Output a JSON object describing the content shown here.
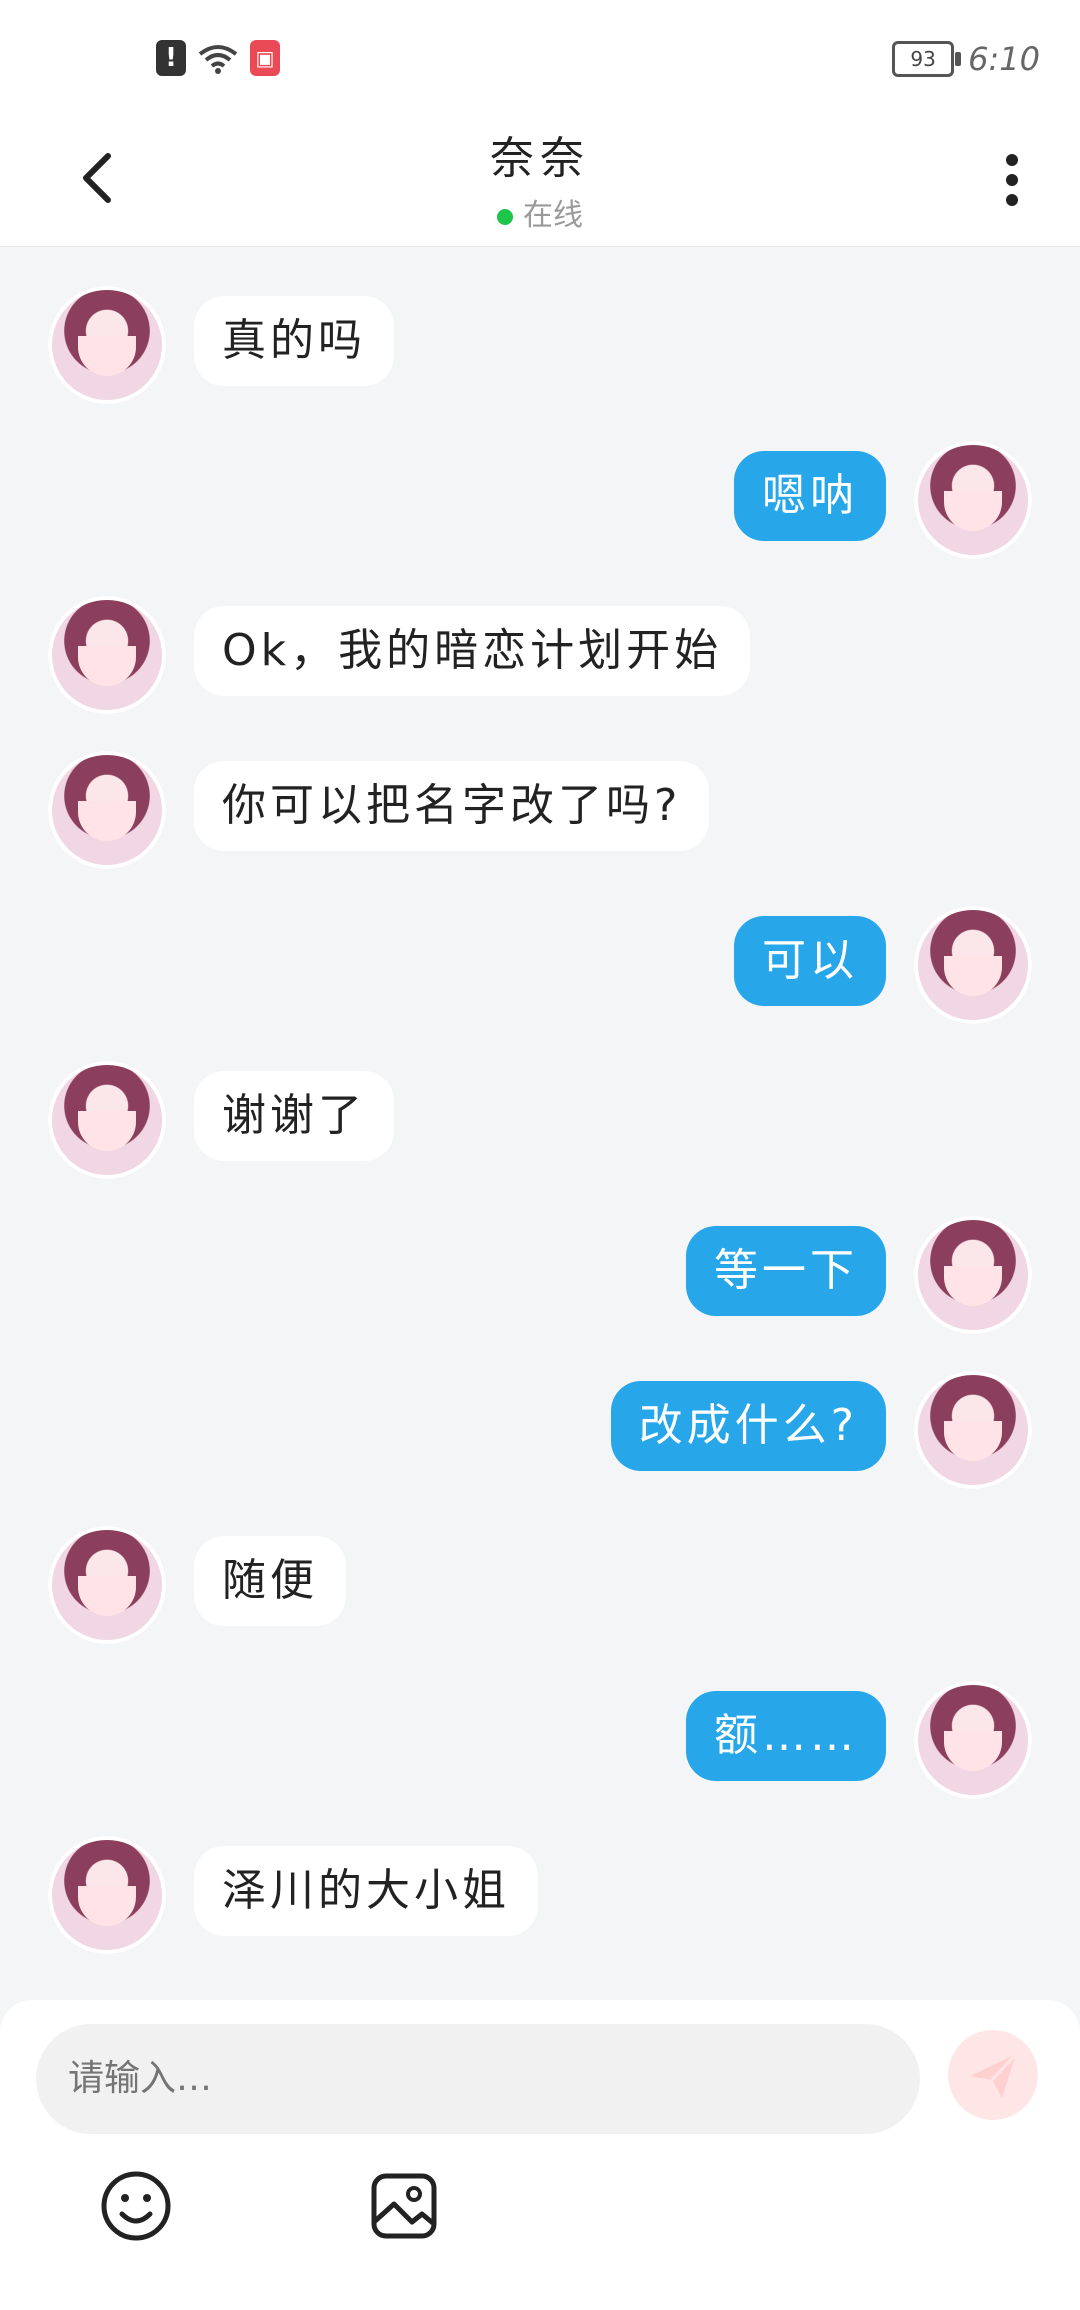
{
  "status_bar": {
    "battery": "93",
    "time": "6:10",
    "icons": [
      "alert-icon",
      "wifi-icon",
      "book-app-icon"
    ]
  },
  "header": {
    "title": "奈奈",
    "status": "在线",
    "status_color": "#1fc44b",
    "icons": [
      "back-icon",
      "more-vertical-icon"
    ]
  },
  "messages": [
    {
      "side": "left",
      "text": "真的吗"
    },
    {
      "side": "right",
      "text": "嗯呐"
    },
    {
      "side": "left",
      "text": "Ok，我的暗恋计划开始"
    },
    {
      "side": "left",
      "text": "你可以把名字改了吗?"
    },
    {
      "side": "right",
      "text": "可以"
    },
    {
      "side": "left",
      "text": "谢谢了"
    },
    {
      "side": "right",
      "text": "等一下"
    },
    {
      "side": "right",
      "text": "改成什么?"
    },
    {
      "side": "left",
      "text": "随便"
    },
    {
      "side": "right",
      "text": "额……"
    },
    {
      "side": "left",
      "text": "泽川的大小姐"
    }
  ],
  "composer": {
    "placeholder": "请输入…",
    "icons": [
      "send-icon",
      "emoji-icon",
      "image-icon"
    ],
    "send_color": "#ffe6e6"
  },
  "colors": {
    "outgoing_bubble": "#27a7ea",
    "incoming_bubble": "#ffffff",
    "chat_background": "#f4f5f7"
  }
}
